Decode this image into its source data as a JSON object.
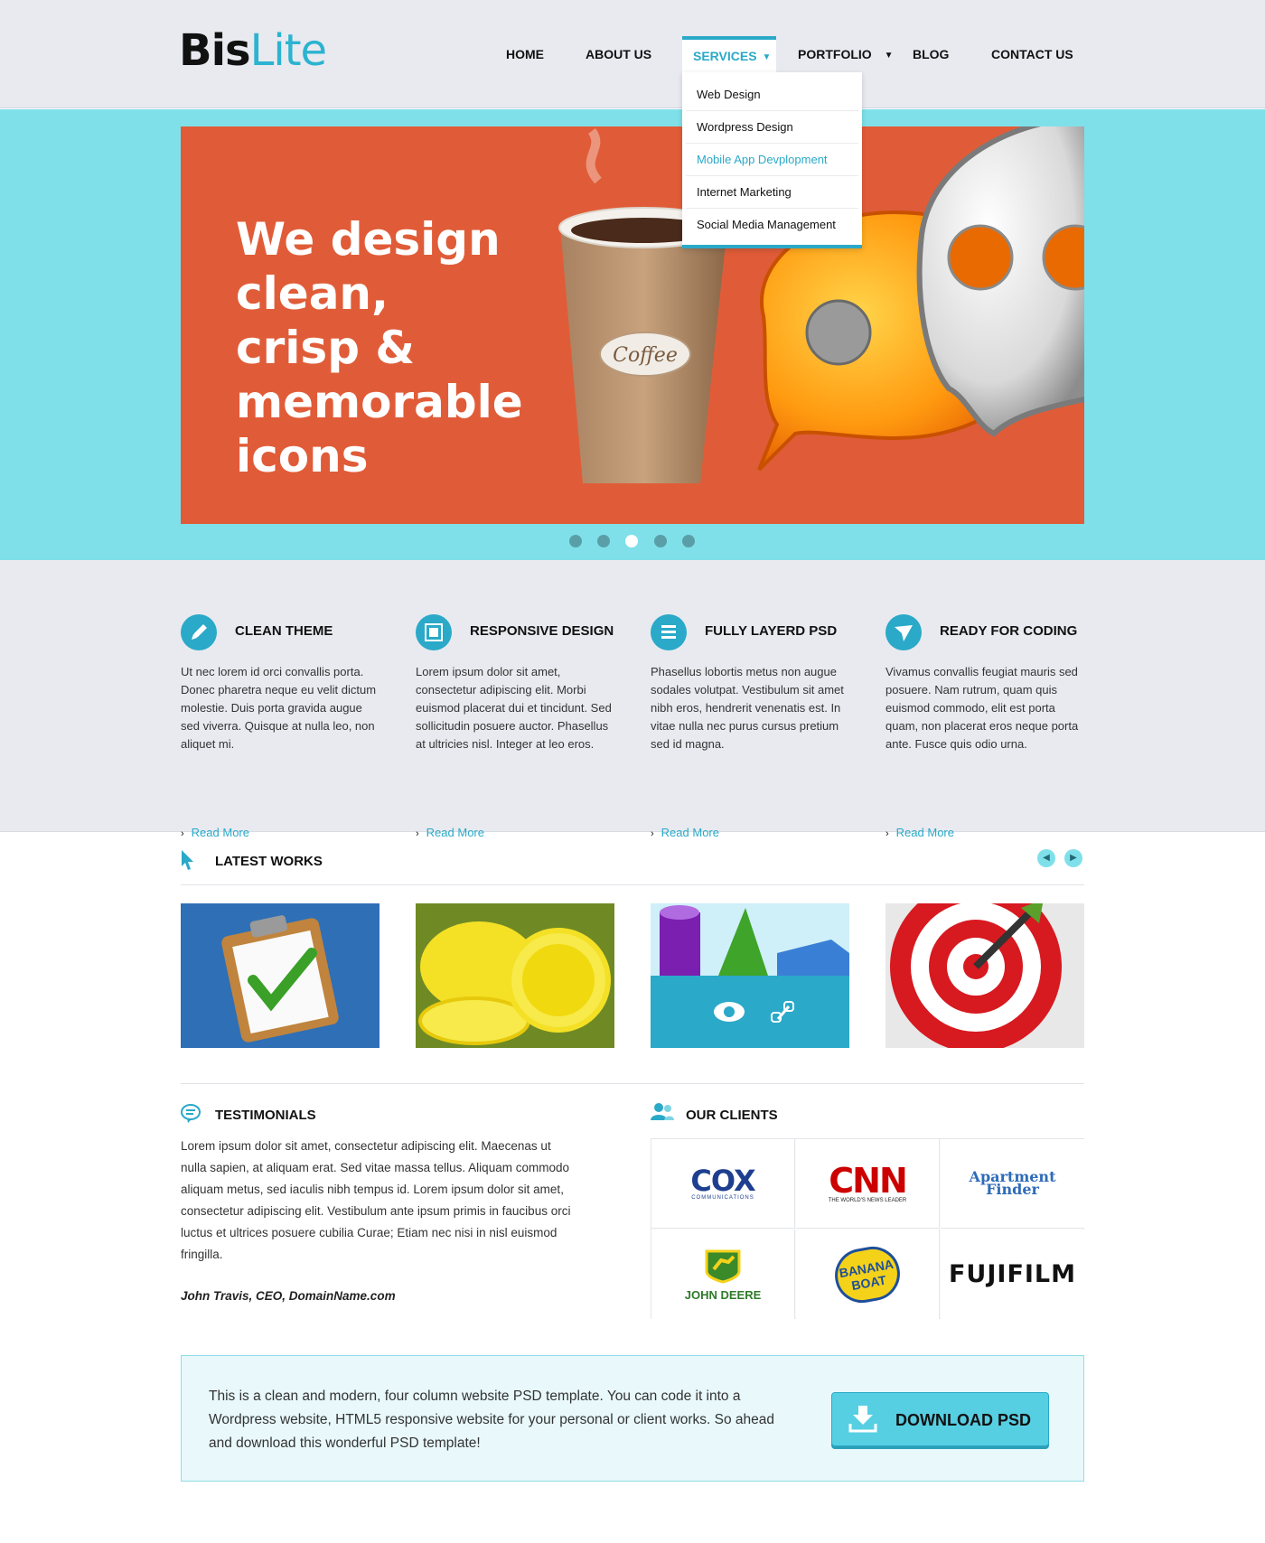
{
  "logo": {
    "part1": "Bis",
    "part2": "Lite"
  },
  "nav": {
    "home": "HOME",
    "about": "ABOUT US",
    "services": "SERVICES",
    "portfolio": "PORTFOLIO",
    "blog": "BLOG",
    "contact": "CONTACT US",
    "services_menu": [
      "Web Design",
      "Wordpress Design",
      "Mobile App Devplopment",
      "Internet Marketing",
      "Social Media Management"
    ]
  },
  "hero": {
    "headline": "We design clean, crisp & memorable icons",
    "coffee_label": "Coffee",
    "active_slide": 3,
    "slide_count": 5
  },
  "features": [
    {
      "icon": "pencil-icon",
      "title": "CLEAN THEME",
      "text": "Ut nec lorem id orci convallis porta. Donec pharetra neque eu velit dictum molestie. Duis porta gravida augue sed viverra. Quisque at nulla leo, non aliquet mi.",
      "more": "Read More"
    },
    {
      "icon": "responsive-icon",
      "title": "RESPONSIVE DESIGN",
      "text": "Lorem ipsum dolor sit amet, consectetur adipiscing elit. Morbi euismod placerat dui et tincidunt. Sed sollicitudin posuere auctor. Phasellus at ultricies nisl. Integer at leo eros.",
      "more": "Read More"
    },
    {
      "icon": "layers-icon",
      "title": "FULLY LAYERD PSD",
      "text": "Phasellus lobortis metus non augue sodales volutpat. Vestibulum sit amet nibh eros, hendrerit venenatis est. In vitae nulla nec purus cursus pretium sed id magna.",
      "more": "Read More"
    },
    {
      "icon": "paper-plane-icon",
      "title": "READY FOR CODING",
      "text": "Vivamus convallis feugiat mauris sed posuere. Nam rutrum, quam quis euismod commodo, elit est porta quam, non placerat eros neque porta ante. Fusce quis odio urna.",
      "more": "Read More"
    }
  ],
  "latest_works": {
    "title": "LATEST WORKS"
  },
  "testimonials": {
    "title": "TESTIMONIALS",
    "text": "Lorem ipsum dolor sit amet, consectetur adipiscing elit. Maecenas ut nulla sapien, at aliquam erat. Sed vitae massa tellus. Aliquam commodo aliquam metus, sed iaculis nibh tempus id. Lorem ipsum dolor sit amet, consectetur adipiscing elit. Vestibulum ante ipsum primis in faucibus orci luctus et ultrices posuere cubilia Curae; Etiam nec nisi in nisl euismod fringilla.",
    "author": "John Travis, CEO, DomainName.com"
  },
  "clients": {
    "title": "OUR CLIENTS",
    "cox": "COX",
    "cox_sub": "COMMUNICATIONS",
    "cnn": "CNN",
    "cnn_sub": "THE WORLD'S NEWS LEADER",
    "apartment": "Apartment Finder",
    "deere": "JOHN DEERE",
    "banana": "BANANA BOAT",
    "fujifilm": "FUJIFILM"
  },
  "cta": {
    "text": "This is a clean and modern, four column website PSD template. You can code it into a Wordpress website, HTML5 responsive website for your personal or client works. So ahead and download this wonderful PSD template!",
    "button": "DOWNLOAD PSD"
  },
  "colors": {
    "accent": "#2aa9c8",
    "hero_bg": "#7fe0ea",
    "slide_bg": "#e05c38",
    "page_bg": "#e8eaf0"
  }
}
